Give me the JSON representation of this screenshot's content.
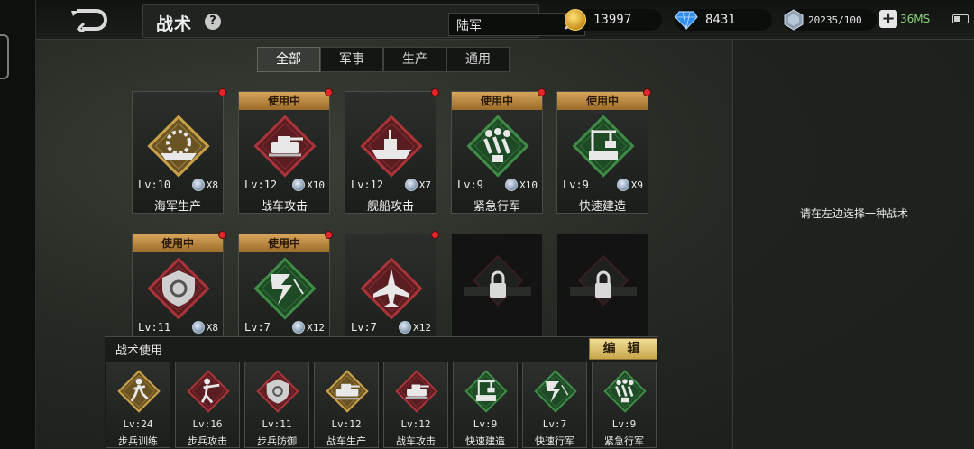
{
  "header": {
    "title": "战术",
    "help": "?",
    "branch": "陆军",
    "gold": "13997",
    "diamond": "8431",
    "energy": "20235/100",
    "ping": "36MS",
    "plus": "+"
  },
  "tabs": [
    "全部",
    "军事",
    "生产",
    "通用"
  ],
  "right_panel": {
    "message": "请在左边选择一种战术"
  },
  "cards": [
    {
      "name": "海军生产",
      "level": "Lv:10",
      "count": "X8",
      "in_use": "",
      "icon": "navy-production-icon",
      "theme": "gold"
    },
    {
      "name": "战车攻击",
      "level": "Lv:12",
      "count": "X10",
      "in_use": "使用中",
      "icon": "tank-attack-icon",
      "theme": "red"
    },
    {
      "name": "舰船攻击",
      "level": "Lv:12",
      "count": "X7",
      "in_use": "",
      "icon": "ship-attack-icon",
      "theme": "red"
    },
    {
      "name": "紧急行军",
      "level": "Lv:9",
      "count": "X10",
      "in_use": "使用中",
      "icon": "march-icon",
      "theme": "green"
    },
    {
      "name": "快速建造",
      "level": "Lv:9",
      "count": "X9",
      "in_use": "使用中",
      "icon": "build-icon",
      "theme": "green"
    },
    {
      "name": "",
      "level": "Lv:11",
      "count": "X8",
      "in_use": "使用中",
      "icon": "shield-defense-icon",
      "theme": "red"
    },
    {
      "name": "",
      "level": "Lv:7",
      "count": "X12",
      "in_use": "使用中",
      "icon": "fast-march-icon",
      "theme": "green"
    },
    {
      "name": "",
      "level": "Lv:7",
      "count": "X12",
      "in_use": "",
      "icon": "jet-attack-icon",
      "theme": "red"
    }
  ],
  "locked_count": 2,
  "usage": {
    "title": "战术使用",
    "edit": "编 辑",
    "slots": [
      {
        "name": "步兵训练",
        "level": "Lv:24",
        "icon": "infantry-training-icon",
        "theme": "gold"
      },
      {
        "name": "步兵攻击",
        "level": "Lv:16",
        "icon": "infantry-attack-icon",
        "theme": "red"
      },
      {
        "name": "步兵防御",
        "level": "Lv:11",
        "icon": "infantry-defense-icon",
        "theme": "red"
      },
      {
        "name": "战车生产",
        "level": "Lv:12",
        "icon": "tank-production-icon",
        "theme": "gold"
      },
      {
        "name": "战车攻击",
        "level": "Lv:12",
        "icon": "tank-attack-icon",
        "theme": "red"
      },
      {
        "name": "快速建造",
        "level": "Lv:9",
        "icon": "build-icon",
        "theme": "green"
      },
      {
        "name": "快速行军",
        "level": "Lv:7",
        "icon": "fast-march-icon",
        "theme": "green"
      },
      {
        "name": "紧急行军",
        "level": "Lv:9",
        "icon": "march-icon",
        "theme": "green"
      }
    ]
  },
  "colors": {
    "gold": "#c9a04a",
    "red": "#a8343a",
    "green": "#3f8a47",
    "in_use": "#c89248",
    "edit": "#e2c877"
  }
}
